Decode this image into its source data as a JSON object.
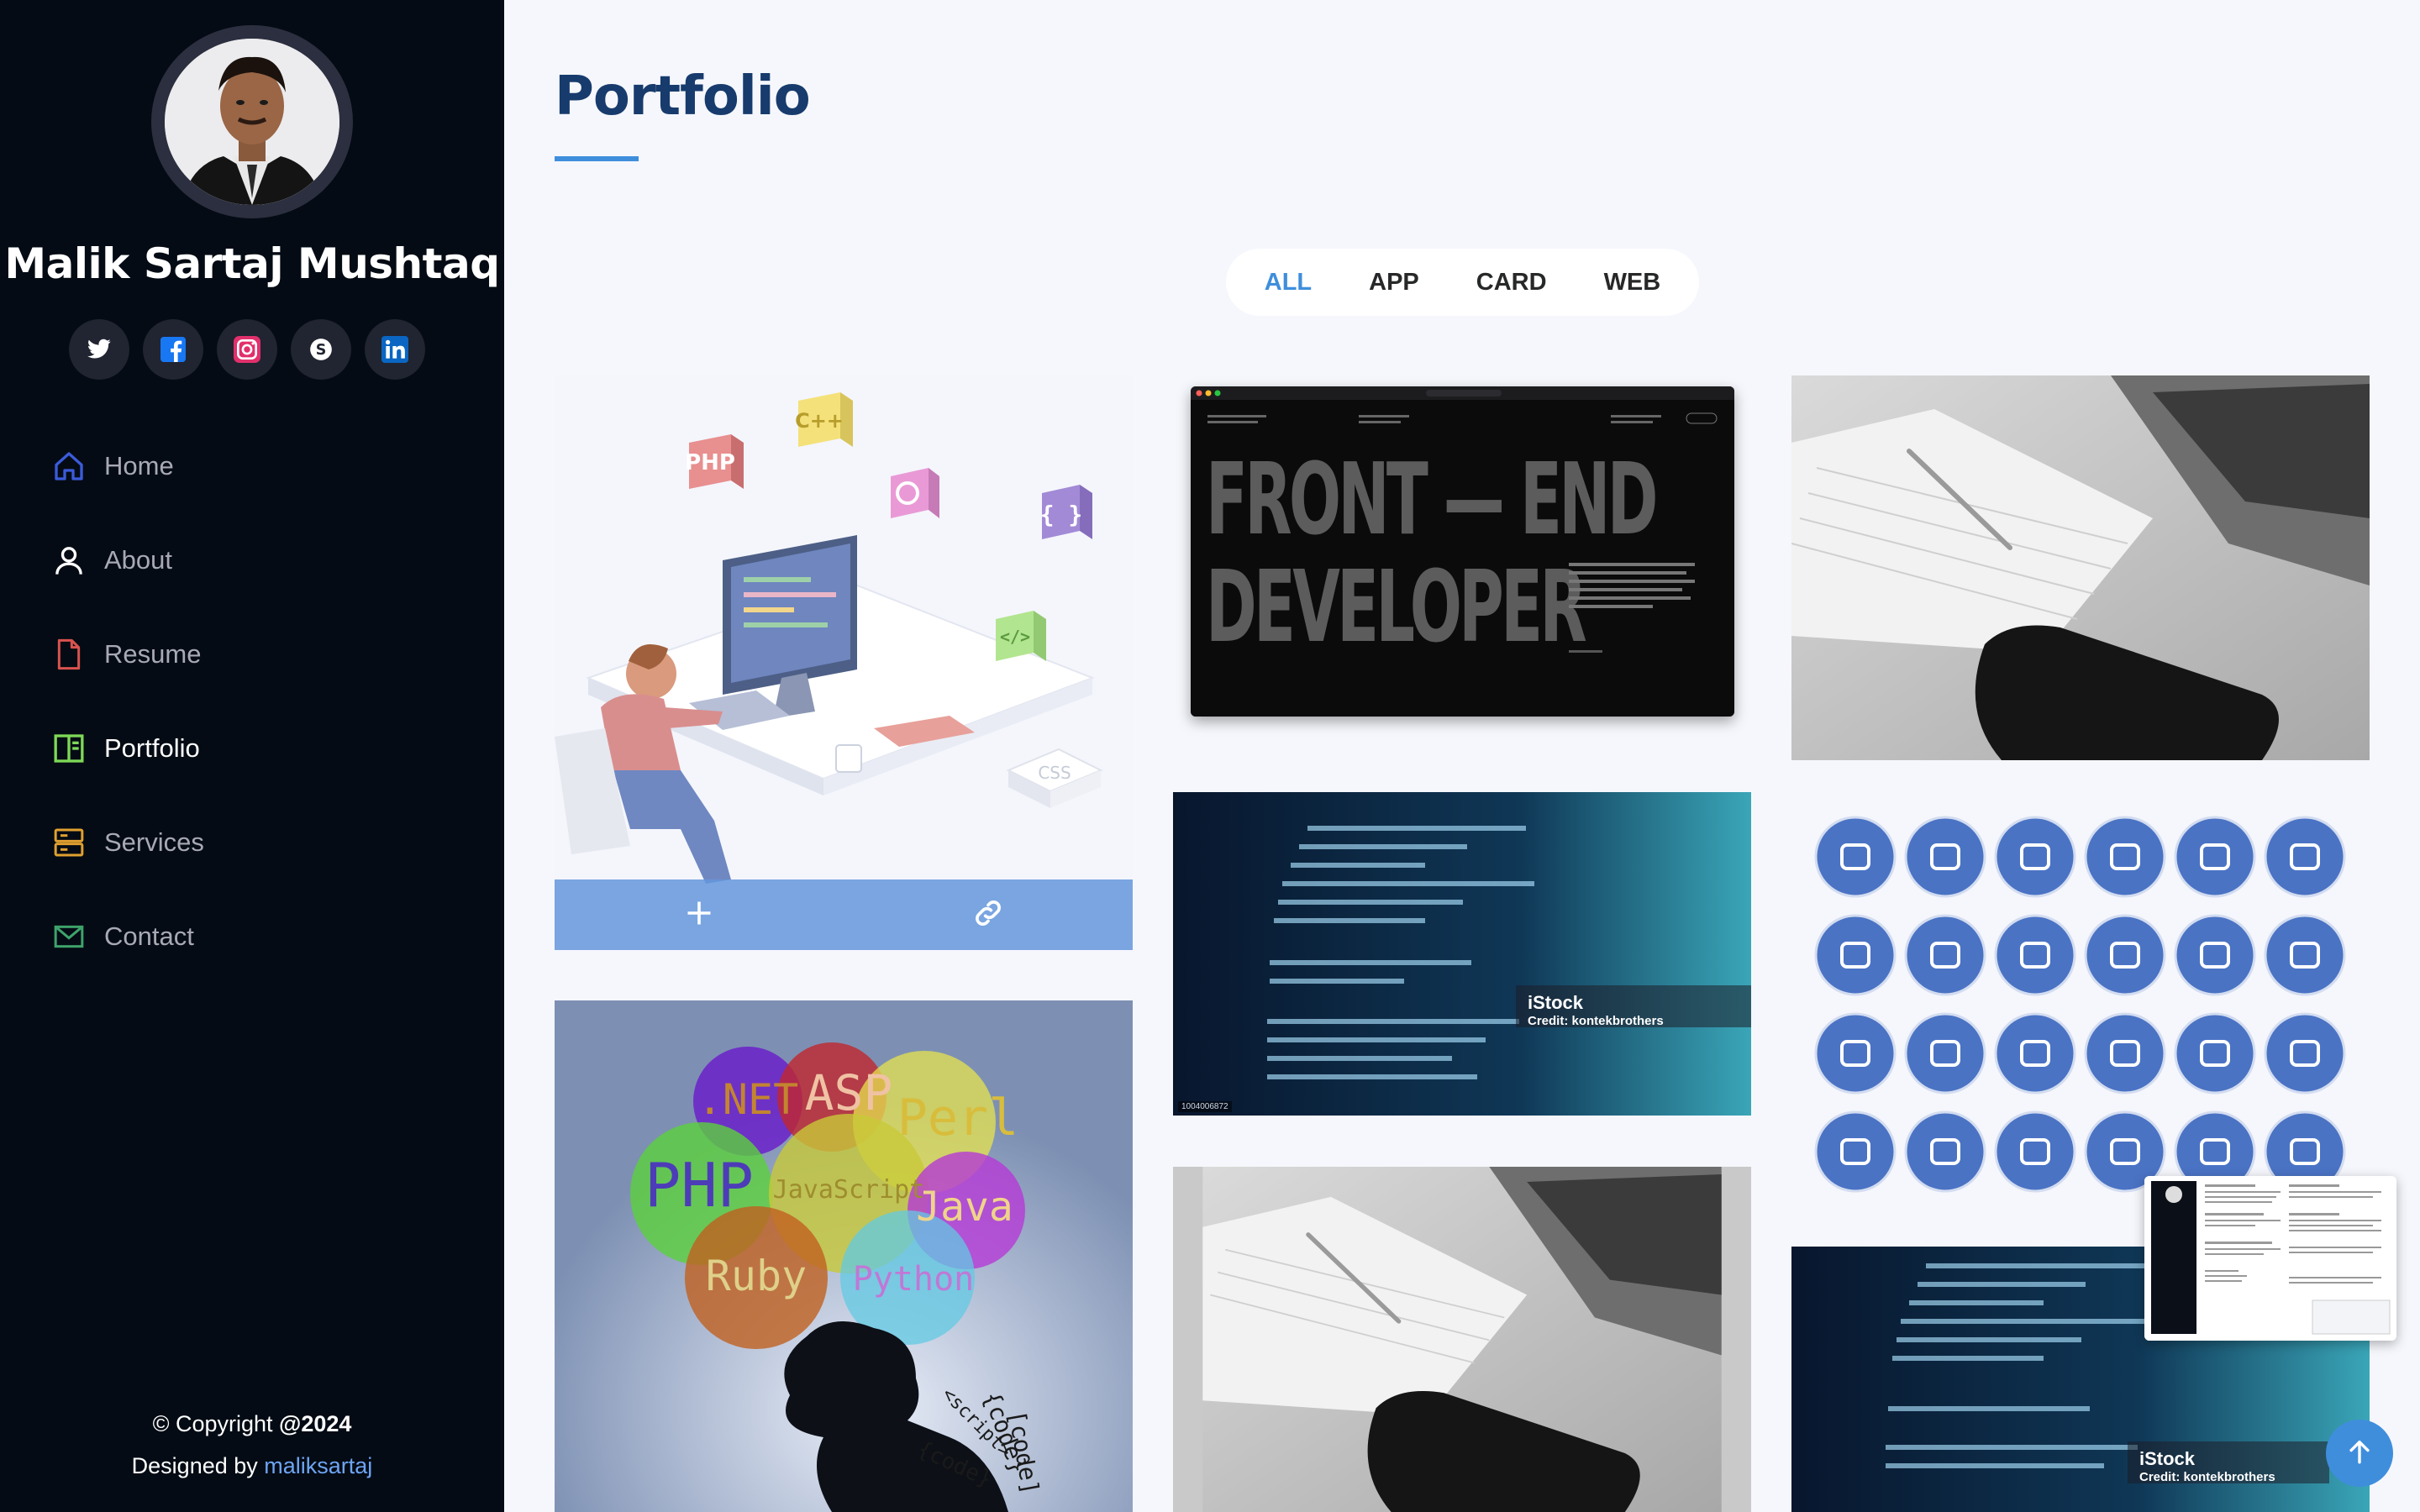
{
  "profile": {
    "name": "Malik Sartaj Mushtaq"
  },
  "social": [
    {
      "icon": "twitter-icon",
      "color": "#ffffff"
    },
    {
      "icon": "facebook-icon",
      "color": "#1877f2"
    },
    {
      "icon": "instagram-icon",
      "color": "#e1306c"
    },
    {
      "icon": "skype-icon",
      "color": "#ffffff"
    },
    {
      "icon": "linkedin-icon",
      "color": "#0a66c2"
    }
  ],
  "nav": {
    "items": [
      {
        "label": "Home",
        "icon": "home-icon",
        "color": "#3b5bdb"
      },
      {
        "label": "About",
        "icon": "person-icon",
        "color": "#ffffff"
      },
      {
        "label": "Resume",
        "icon": "file-icon",
        "color": "#d9534f"
      },
      {
        "label": "Portfolio",
        "icon": "book-half-icon",
        "color": "#7ed957",
        "active": true
      },
      {
        "label": "Services",
        "icon": "server-icon",
        "color": "#e0a030"
      },
      {
        "label": "Contact",
        "icon": "envelope-icon",
        "color": "#3ea36b"
      }
    ]
  },
  "footer": {
    "copyright_prefix": "© Copyright ",
    "copyright_year": "@2024",
    "designed_prefix": "Designed by ",
    "designed_link": "maliksartaj"
  },
  "main": {
    "title": "Portfolio",
    "filters": [
      {
        "label": "ALL",
        "active": true
      },
      {
        "label": "APP"
      },
      {
        "label": "CARD"
      },
      {
        "label": "WEB"
      }
    ]
  },
  "portfolio": {
    "frontend": {
      "line1": "FRONT — END",
      "line2": "DEVELOPER"
    },
    "istock": {
      "brand": "iStock",
      "credit": "Credit: kontekbrothers",
      "image_id": "1004006872"
    },
    "langs": {
      "bubbles": [
        ".NET",
        "ASP",
        "Perl",
        "PHP",
        "JavaScript",
        "Java",
        "Ruby",
        "Python"
      ],
      "scribble": [
        "[code]",
        "{code}",
        "<script>",
        "{code}"
      ]
    },
    "dev": {
      "cubes": [
        "PHP",
        "C++",
        "{ }",
        "</>",
        "CSS"
      ]
    }
  },
  "theme": {
    "accent": "#3f8edc",
    "sidebar_bg": "#040b14",
    "page_bg": "#f5f7fc",
    "title_color": "#173b6c",
    "icon_circle": "#4a73c4"
  }
}
